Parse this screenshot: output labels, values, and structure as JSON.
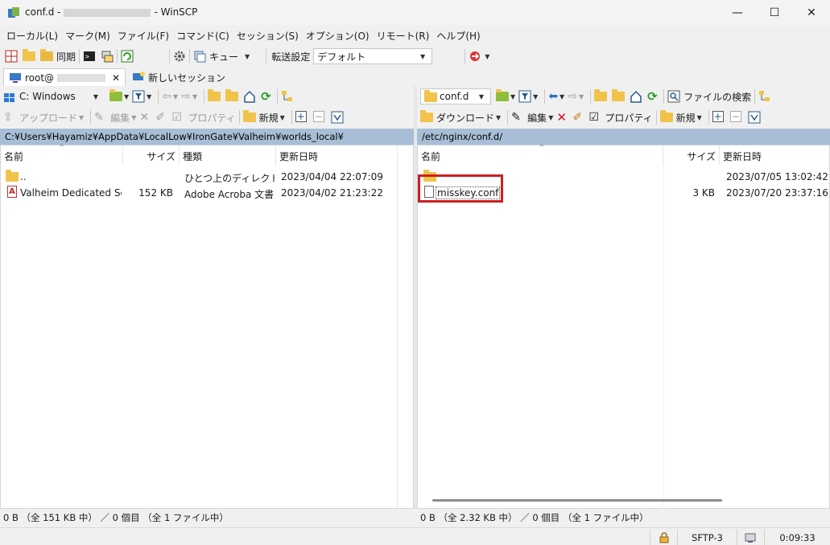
{
  "window": {
    "title_left": "conf.d -",
    "title_right": "- WinSCP",
    "minimize": "—",
    "maximize": "☐",
    "close": "✕"
  },
  "menu": [
    "ローカル(L)",
    "マーク(M)",
    "ファイル(F)",
    "コマンド(C)",
    "セッション(S)",
    "オプション(O)",
    "リモート(R)",
    "ヘルプ(H)"
  ],
  "toolbar": {
    "sync": "同期",
    "queue": "キュー",
    "transfer_label": "転送設定",
    "transfer_value": "デフォルト"
  },
  "tabs": {
    "session": "root@",
    "session_close": "✕",
    "new_session": "新しいセッション"
  },
  "local": {
    "drive": "C: Windows",
    "upload": "アップロード",
    "edit": "編集",
    "properties": "プロパティ",
    "new": "新規",
    "path": "C:¥Users¥Hayamiz¥AppData¥LocalLow¥IronGate¥Valheim¥worlds_local¥",
    "columns": [
      "名前",
      "サイズ",
      "種類",
      "更新日時"
    ],
    "rows": [
      {
        "name": "..",
        "size": "",
        "type": "ひとつ上のディレクトリ",
        "date": "2023/04/04  22:07:09"
      },
      {
        "name": "Valheim Dedicated Se...",
        "size": "152 KB",
        "type": "Adobe Acroba 文書",
        "date": "2023/04/02  21:23:22"
      }
    ],
    "status": "0 B （全 151 KB 中） ／ 0 個目 （全 1 ファイル中）"
  },
  "remote": {
    "dir": "conf.d",
    "download": "ダウンロード",
    "edit": "編集",
    "properties": "プロパティ",
    "new": "新規",
    "find": "ファイルの検索",
    "path": "/etc/nginx/conf.d/",
    "columns": [
      "名前",
      "サイズ",
      "更新日時"
    ],
    "rows": [
      {
        "name": "",
        "size": "",
        "date": "2023/07/05 13:02:42"
      },
      {
        "name": "misskey.conf",
        "size": "3 KB",
        "date": "2023/07/20 23:37:16"
      }
    ],
    "status": "0 B （全 2.32 KB 中） ／ 0 個目 （全 1 ファイル中）"
  },
  "statusbar": {
    "protocol": "SFTP-3",
    "time": "0:09:33"
  },
  "colors": {
    "path_bar": "#a7bed6",
    "highlight": "#cc1f1f",
    "folder": "#f1c34a"
  }
}
